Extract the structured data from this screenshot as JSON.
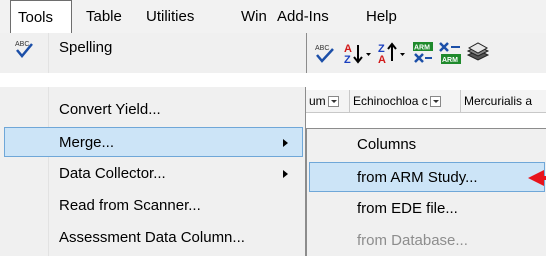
{
  "menubar": {
    "items": [
      {
        "label": "Tools"
      },
      {
        "label": "Table"
      },
      {
        "label": "Utilities"
      },
      {
        "label": "Win"
      },
      {
        "label": "Add-Ins"
      },
      {
        "label": "Help"
      }
    ]
  },
  "tools_menu": {
    "top_item": {
      "label": "Spelling",
      "icon": "spell-check-icon"
    },
    "items": [
      {
        "label": "Convert Yield..."
      },
      {
        "label": "Merge..."
      },
      {
        "label": "Data Collector..."
      },
      {
        "label": "Read from Scanner..."
      },
      {
        "label": "Assessment Data Column..."
      }
    ]
  },
  "merge_submenu": {
    "items": [
      {
        "label": "Columns"
      },
      {
        "label": "from ARM Study..."
      },
      {
        "label": "from EDE file..."
      },
      {
        "label": "from Database..."
      }
    ]
  },
  "grid_header": {
    "cols": [
      {
        "label": "um"
      },
      {
        "label": "Echinochloa c"
      },
      {
        "label": "Mercurialis a"
      }
    ]
  },
  "colors": {
    "highlight": "#cce4f7",
    "highlight_border": "#6fa7d8",
    "menu_bg": "#f0f0f0",
    "disabled_text": "#8d8d8d",
    "pointer": "#e8141c"
  }
}
